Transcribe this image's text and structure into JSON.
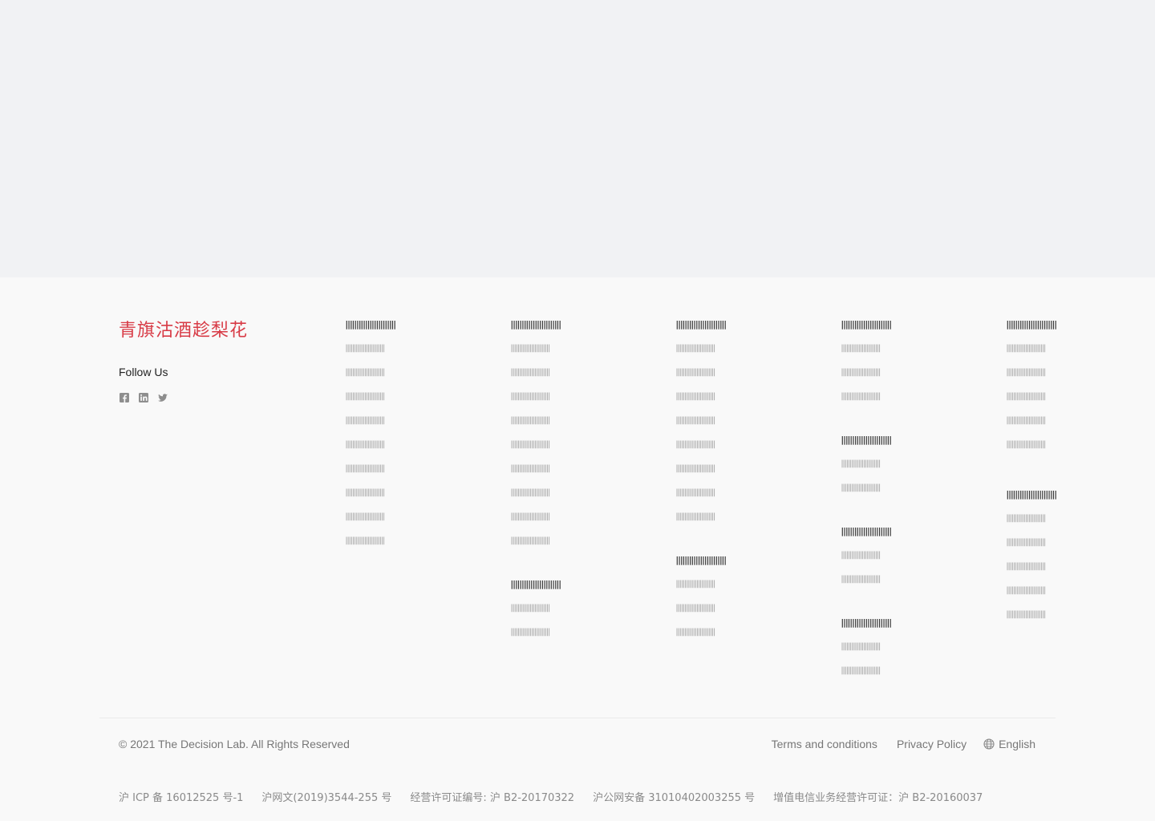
{
  "brand": {
    "name": "青旗沽酒趁梨花",
    "color": "#d83b46"
  },
  "follow": {
    "label": "Follow Us",
    "icons": [
      "facebook-icon",
      "linkedin-icon",
      "twitter-icon"
    ]
  },
  "columns": [
    {
      "blocks": [
        {
          "heading": "|||||||||||||||||||||||",
          "links": [
            "|||||||||||||||||||||||",
            "|||||||||||||||||||||||",
            "|||||||||||||||||||||||",
            "|||||||||||||||||||||||",
            "|||||||||||||||||||||||",
            "|||||||||||||||||||||||",
            "|||||||||||||||||||||||",
            "|||||||||||||||||||||||",
            "|||||||||||||||||||||||"
          ]
        }
      ]
    },
    {
      "blocks": [
        {
          "heading": "|||||||||||||||||||||||",
          "links": [
            "|||||||||||||||||||||||",
            "|||||||||||||||||||||||",
            "|||||||||||||||||||||||",
            "|||||||||||||||||||||||",
            "|||||||||||||||||||||||",
            "|||||||||||||||||||||||",
            "|||||||||||||||||||||||",
            "|||||||||||||||||||||||",
            "|||||||||||||||||||||||"
          ]
        },
        {
          "heading": "|||||||||||||||||||||||",
          "links": [
            "|||||||||||||||||||||||",
            "|||||||||||||||||||||||"
          ]
        }
      ]
    },
    {
      "blocks": [
        {
          "heading": "|||||||||||||||||||||||",
          "links": [
            "|||||||||||||||||||||||",
            "|||||||||||||||||||||||",
            "|||||||||||||||||||||||",
            "|||||||||||||||||||||||",
            "|||||||||||||||||||||||",
            "|||||||||||||||||||||||",
            "|||||||||||||||||||||||",
            "|||||||||||||||||||||||"
          ]
        },
        {
          "heading": "|||||||||||||||||||||||",
          "links": [
            "|||||||||||||||||||||||",
            "|||||||||||||||||||||||",
            "|||||||||||||||||||||||"
          ]
        }
      ]
    },
    {
      "blocks": [
        {
          "heading": "|||||||||||||||||||||||",
          "links": [
            "|||||||||||||||||||||||",
            "|||||||||||||||||||||||",
            "|||||||||||||||||||||||"
          ]
        },
        {
          "heading": "|||||||||||||||||||||||",
          "links": [
            "|||||||||||||||||||||||",
            "|||||||||||||||||||||||"
          ]
        },
        {
          "heading": "|||||||||||||||||||||||",
          "links": [
            "|||||||||||||||||||||||",
            "|||||||||||||||||||||||"
          ]
        },
        {
          "heading": "|||||||||||||||||||||||",
          "links": [
            "|||||||||||||||||||||||",
            "|||||||||||||||||||||||"
          ]
        }
      ]
    },
    {
      "blocks": [
        {
          "heading": "|||||||||||||||||||||||",
          "links": [
            "|||||||||||||||||||||||",
            "|||||||||||||||||||||||",
            "|||||||||||||||||||||||",
            "|||||||||||||||||||||||",
            "|||||||||||||||||||||||"
          ]
        },
        {
          "heading": "|||||||||||||||||||||||",
          "links": [
            "|||||||||||||||||||||||",
            "|||||||||||||||||||||||",
            "|||||||||||||||||||||||",
            "|||||||||||||||||||||||",
            "|||||||||||||||||||||||"
          ]
        }
      ]
    }
  ],
  "bottom": {
    "copyright": "© 2021 The Decision Lab. All Rights Reserved",
    "terms": "Terms and conditions",
    "privacy": "Privacy Policy",
    "language": "English",
    "language_icon": "globe-icon"
  },
  "legal": [
    "沪 ICP 备 16012525 号-1",
    "沪网文(2019)3544-255 号",
    "经营许可证编号: 沪 B2-20170322",
    "沪公网安备 31010402003255 号",
    "增值电信业务经营许可证：沪 B2-20160037"
  ]
}
